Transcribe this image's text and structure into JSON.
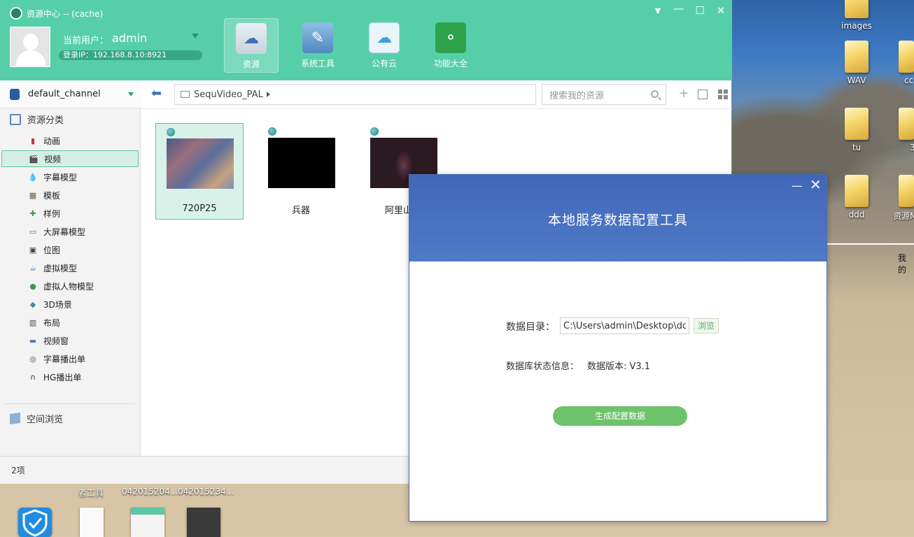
{
  "window": {
    "title": "资源中心 -- (cache)",
    "controls": {
      "dropdown": "▼",
      "minimize": "—",
      "maximize": "☐",
      "close": "✕"
    }
  },
  "user": {
    "label": "当前用户：",
    "name": "admin",
    "ip": "登录IP：192.168.8.10:8921"
  },
  "top_nav": [
    {
      "label": "资源",
      "icon": "cloud-drive-icon",
      "active": true
    },
    {
      "label": "系统工具",
      "icon": "tools-icon",
      "active": false
    },
    {
      "label": "公有云",
      "icon": "public-cloud-icon",
      "active": false
    },
    {
      "label": "功能大全",
      "icon": "share-icon",
      "active": false
    }
  ],
  "sidebar": {
    "channel": "default_channel",
    "category_header": "资源分类",
    "items": [
      {
        "label": "动画",
        "icon": "animation-icon",
        "color": "#c23b3b"
      },
      {
        "label": "视频",
        "icon": "clapper-icon",
        "color": "#333333",
        "selected": true
      },
      {
        "label": "字幕模型",
        "icon": "droplet-icon",
        "color": "#2b6fb5"
      },
      {
        "label": "模板",
        "icon": "template-icon",
        "color": "#6b5a3a"
      },
      {
        "label": "样例",
        "icon": "puzzle-icon",
        "color": "#3f9b45"
      },
      {
        "label": "大屏幕模型",
        "icon": "monitor-icon",
        "color": "#666666"
      },
      {
        "label": "位图",
        "icon": "image-icon",
        "color": "#444444"
      },
      {
        "label": "虚拟模型",
        "icon": "teapot-icon",
        "color": "#4a7fc0"
      },
      {
        "label": "虚拟人物模型",
        "icon": "person-icon",
        "color": "#3f9b45"
      },
      {
        "label": "3D场景",
        "icon": "cube-icon",
        "color": "#3f8aa0"
      },
      {
        "label": "布局",
        "icon": "layout-icon",
        "color": "#444444"
      },
      {
        "label": "视频窗",
        "icon": "video-window-icon",
        "color": "#5a7fb0"
      },
      {
        "label": "字幕播出单",
        "icon": "caption-playlist-icon",
        "color": "#444444"
      },
      {
        "label": "HG播出单",
        "icon": "headphones-icon",
        "color": "#333333"
      }
    ],
    "space_browse": "空间浏览"
  },
  "toolbar": {
    "path": "SequVideo_PAL",
    "search_placeholder": "搜索我的资源"
  },
  "files": [
    {
      "name": "720P25",
      "selected": true,
      "thumb": "crowd"
    },
    {
      "name": "兵器",
      "selected": false,
      "thumb": "black"
    },
    {
      "name": "阿里山的",
      "selected": false,
      "thumb": "stage"
    }
  ],
  "status": {
    "count": "2项"
  },
  "desktop": {
    "icons": [
      "images",
      "WAV",
      "tu",
      "ddd",
      "cc",
      "3",
      "资源M"
    ],
    "side_text": "我的",
    "bottom_labels": [
      "者工具",
      "042015204...",
      "042015234..."
    ]
  },
  "dialog": {
    "title": "本地服务数据配置工具",
    "dir_label": "数据目录：",
    "dir_value": "C:\\Users\\admin\\Desktop\\ddd",
    "browse_label": "浏览",
    "db_label": "数据库状态信息：",
    "db_value": "数据版本: V3.1",
    "generate_label": "生成配置数据"
  }
}
